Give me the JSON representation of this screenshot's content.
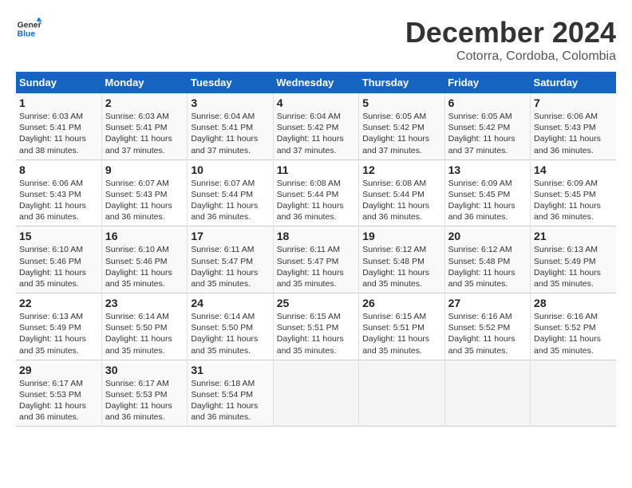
{
  "logo": {
    "line1": "General",
    "line2": "Blue"
  },
  "title": "December 2024",
  "subtitle": "Cotorra, Cordoba, Colombia",
  "days_of_week": [
    "Sunday",
    "Monday",
    "Tuesday",
    "Wednesday",
    "Thursday",
    "Friday",
    "Saturday"
  ],
  "weeks": [
    [
      {
        "day": 1,
        "info": "Sunrise: 6:03 AM\nSunset: 5:41 PM\nDaylight: 11 hours\nand 38 minutes."
      },
      {
        "day": 2,
        "info": "Sunrise: 6:03 AM\nSunset: 5:41 PM\nDaylight: 11 hours\nand 37 minutes."
      },
      {
        "day": 3,
        "info": "Sunrise: 6:04 AM\nSunset: 5:41 PM\nDaylight: 11 hours\nand 37 minutes."
      },
      {
        "day": 4,
        "info": "Sunrise: 6:04 AM\nSunset: 5:42 PM\nDaylight: 11 hours\nand 37 minutes."
      },
      {
        "day": 5,
        "info": "Sunrise: 6:05 AM\nSunset: 5:42 PM\nDaylight: 11 hours\nand 37 minutes."
      },
      {
        "day": 6,
        "info": "Sunrise: 6:05 AM\nSunset: 5:42 PM\nDaylight: 11 hours\nand 37 minutes."
      },
      {
        "day": 7,
        "info": "Sunrise: 6:06 AM\nSunset: 5:43 PM\nDaylight: 11 hours\nand 36 minutes."
      }
    ],
    [
      {
        "day": 8,
        "info": "Sunrise: 6:06 AM\nSunset: 5:43 PM\nDaylight: 11 hours\nand 36 minutes."
      },
      {
        "day": 9,
        "info": "Sunrise: 6:07 AM\nSunset: 5:43 PM\nDaylight: 11 hours\nand 36 minutes."
      },
      {
        "day": 10,
        "info": "Sunrise: 6:07 AM\nSunset: 5:44 PM\nDaylight: 11 hours\nand 36 minutes."
      },
      {
        "day": 11,
        "info": "Sunrise: 6:08 AM\nSunset: 5:44 PM\nDaylight: 11 hours\nand 36 minutes."
      },
      {
        "day": 12,
        "info": "Sunrise: 6:08 AM\nSunset: 5:44 PM\nDaylight: 11 hours\nand 36 minutes."
      },
      {
        "day": 13,
        "info": "Sunrise: 6:09 AM\nSunset: 5:45 PM\nDaylight: 11 hours\nand 36 minutes."
      },
      {
        "day": 14,
        "info": "Sunrise: 6:09 AM\nSunset: 5:45 PM\nDaylight: 11 hours\nand 36 minutes."
      }
    ],
    [
      {
        "day": 15,
        "info": "Sunrise: 6:10 AM\nSunset: 5:46 PM\nDaylight: 11 hours\nand 35 minutes."
      },
      {
        "day": 16,
        "info": "Sunrise: 6:10 AM\nSunset: 5:46 PM\nDaylight: 11 hours\nand 35 minutes."
      },
      {
        "day": 17,
        "info": "Sunrise: 6:11 AM\nSunset: 5:47 PM\nDaylight: 11 hours\nand 35 minutes."
      },
      {
        "day": 18,
        "info": "Sunrise: 6:11 AM\nSunset: 5:47 PM\nDaylight: 11 hours\nand 35 minutes."
      },
      {
        "day": 19,
        "info": "Sunrise: 6:12 AM\nSunset: 5:48 PM\nDaylight: 11 hours\nand 35 minutes."
      },
      {
        "day": 20,
        "info": "Sunrise: 6:12 AM\nSunset: 5:48 PM\nDaylight: 11 hours\nand 35 minutes."
      },
      {
        "day": 21,
        "info": "Sunrise: 6:13 AM\nSunset: 5:49 PM\nDaylight: 11 hours\nand 35 minutes."
      }
    ],
    [
      {
        "day": 22,
        "info": "Sunrise: 6:13 AM\nSunset: 5:49 PM\nDaylight: 11 hours\nand 35 minutes."
      },
      {
        "day": 23,
        "info": "Sunrise: 6:14 AM\nSunset: 5:50 PM\nDaylight: 11 hours\nand 35 minutes."
      },
      {
        "day": 24,
        "info": "Sunrise: 6:14 AM\nSunset: 5:50 PM\nDaylight: 11 hours\nand 35 minutes."
      },
      {
        "day": 25,
        "info": "Sunrise: 6:15 AM\nSunset: 5:51 PM\nDaylight: 11 hours\nand 35 minutes."
      },
      {
        "day": 26,
        "info": "Sunrise: 6:15 AM\nSunset: 5:51 PM\nDaylight: 11 hours\nand 35 minutes."
      },
      {
        "day": 27,
        "info": "Sunrise: 6:16 AM\nSunset: 5:52 PM\nDaylight: 11 hours\nand 35 minutes."
      },
      {
        "day": 28,
        "info": "Sunrise: 6:16 AM\nSunset: 5:52 PM\nDaylight: 11 hours\nand 35 minutes."
      }
    ],
    [
      {
        "day": 29,
        "info": "Sunrise: 6:17 AM\nSunset: 5:53 PM\nDaylight: 11 hours\nand 36 minutes."
      },
      {
        "day": 30,
        "info": "Sunrise: 6:17 AM\nSunset: 5:53 PM\nDaylight: 11 hours\nand 36 minutes."
      },
      {
        "day": 31,
        "info": "Sunrise: 6:18 AM\nSunset: 5:54 PM\nDaylight: 11 hours\nand 36 minutes."
      },
      {
        "day": null,
        "info": ""
      },
      {
        "day": null,
        "info": ""
      },
      {
        "day": null,
        "info": ""
      },
      {
        "day": null,
        "info": ""
      }
    ]
  ]
}
